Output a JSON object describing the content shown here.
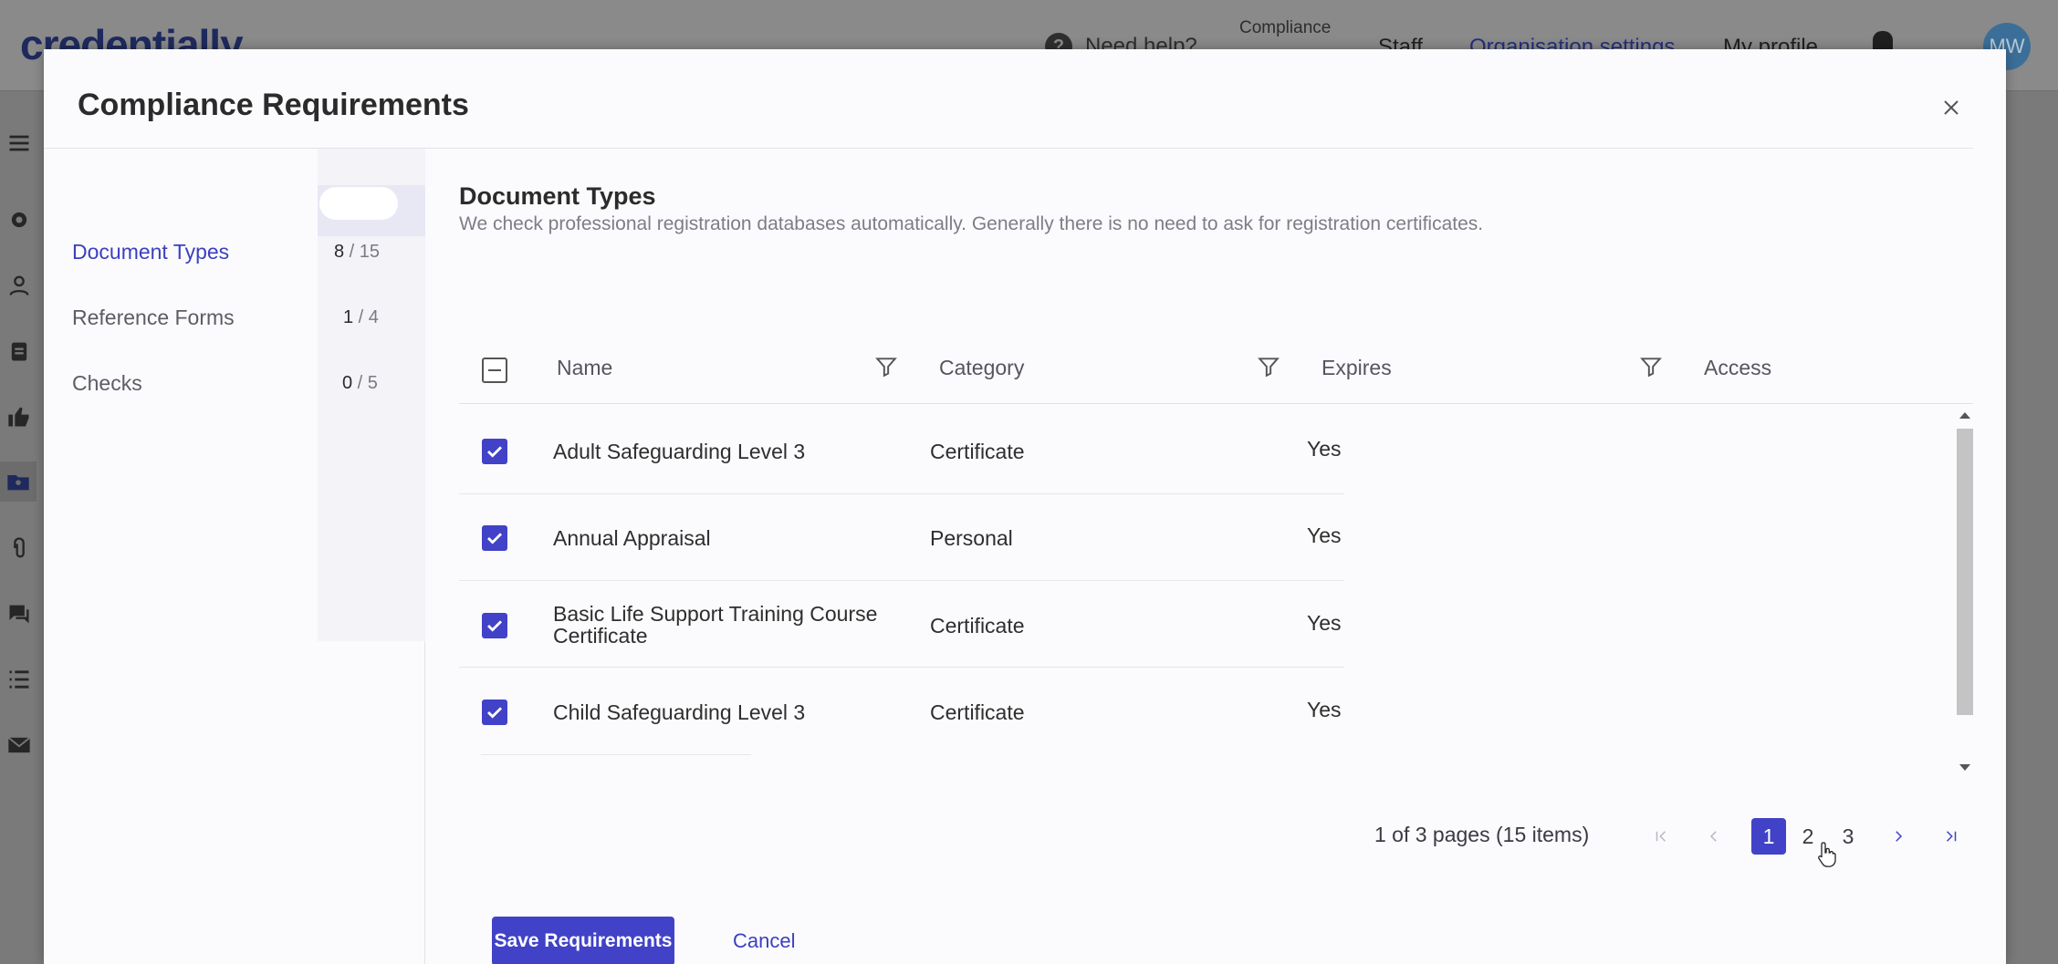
{
  "app": {
    "logo_text": "credentially",
    "help_label": "Need help?",
    "compliance_label": "Compliance",
    "nav": [
      "Staff",
      "Organisation settings",
      "My profile"
    ],
    "avatar_initials": "MW"
  },
  "modal": {
    "title": "Compliance Requirements",
    "left_nav": [
      {
        "label": "Document Types",
        "selected": "8",
        "total": "15",
        "active": true
      },
      {
        "label": "Reference Forms",
        "selected": "1",
        "total": "4",
        "active": false
      },
      {
        "label": "Checks",
        "selected": "0",
        "total": "5",
        "active": false
      }
    ],
    "count_separator": " / ",
    "content": {
      "title": "Document Types",
      "subtitle": "We check professional registration databases automatically. Generally there is no need to ask for registration certificates."
    },
    "table": {
      "columns": [
        "Name",
        "Category",
        "Expires",
        "Access"
      ],
      "rows": [
        {
          "name": "Adult Safeguarding Level 3",
          "category": "Certificate",
          "expires": "Yes",
          "checked": true
        },
        {
          "name": "Annual Appraisal",
          "category": "Personal",
          "expires": "Yes",
          "checked": true
        },
        {
          "name_line1": "Basic Life Support Training Course",
          "name_line2": "Certificate",
          "category": "Certificate",
          "expires": "Yes",
          "checked": true
        },
        {
          "name": "Child Safeguarding Level 3",
          "category": "Certificate",
          "expires": "Yes",
          "checked": true
        }
      ]
    },
    "pager": {
      "info": "1 of 3 pages (15 items)",
      "pages": [
        "1",
        "2",
        "3"
      ],
      "current": "1"
    },
    "buttons": {
      "save": "Save Requirements",
      "cancel": "Cancel"
    }
  },
  "colors": {
    "accent": "#4142c7",
    "link": "#3d3fbf",
    "overlay": "#7a7a7a"
  }
}
